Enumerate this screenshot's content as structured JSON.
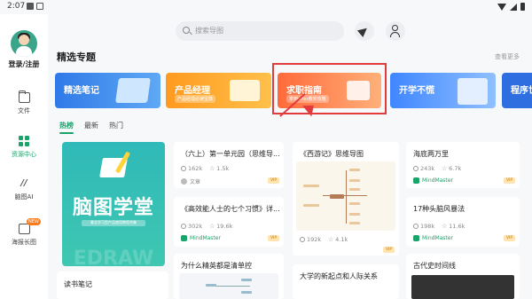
{
  "status_bar": {
    "time": "2:07"
  },
  "sidebar": {
    "login_label": "登录/注册",
    "items": [
      {
        "label": "文件",
        "icon": "folder-icon"
      },
      {
        "label": "资源中心",
        "icon": "grid-icon"
      },
      {
        "label": "脑图AI",
        "icon": "ai-icon"
      },
      {
        "label": "海报长图",
        "icon": "poster-icon",
        "badge": "NEW"
      }
    ]
  },
  "search": {
    "placeholder": "搜索导图"
  },
  "section": {
    "title": "精选专题",
    "see_more": "查看更多"
  },
  "banners": [
    {
      "title": "精选笔记",
      "subtitle": ""
    },
    {
      "title": "产品经理",
      "subtitle": "产品经理必读宝典"
    },
    {
      "title": "求职指南",
      "subtitle": "拿到offer教你攻略"
    },
    {
      "title": "开学不慌",
      "subtitle": ""
    },
    {
      "title": "程序世",
      "subtitle": ""
    }
  ],
  "tabs": [
    "热榜",
    "最新",
    "热门"
  ],
  "hero": {
    "title": "脑图学堂",
    "subtitle": "最全学习型产品使用教程合集",
    "watermark": "EDRAW"
  },
  "cards": {
    "c1": {
      "title": "（六上）第一单元园（思维导...",
      "views": "162k",
      "stars": "1.5k",
      "author": "文章"
    },
    "c2": {
      "title": "《高效能人士的七个习惯》详...",
      "views": "302k",
      "stars": "19.6k",
      "author": "MindMaster"
    },
    "c3": {
      "title": "《西游记》思维导图",
      "views": "192k",
      "stars": "4.1k",
      "author": ""
    },
    "c4": {
      "title": "海底两万里",
      "views": "243k",
      "stars": "6.7k",
      "author": "MindMaster"
    },
    "c5": {
      "title": "17种头脑风暴法",
      "views": "198k",
      "stars": "11.6k",
      "author": "MindMaster"
    },
    "c6": {
      "title": "读书笔记"
    },
    "c7": {
      "title": "为什么精英都是清单控"
    },
    "c8": {
      "title": "大学的新起点和人际关系"
    },
    "c9": {
      "title": "古代史时间线"
    }
  },
  "vip_label": "VIP",
  "colors": {
    "accent": "#1aa36b",
    "highlight": "#e23b3b"
  }
}
